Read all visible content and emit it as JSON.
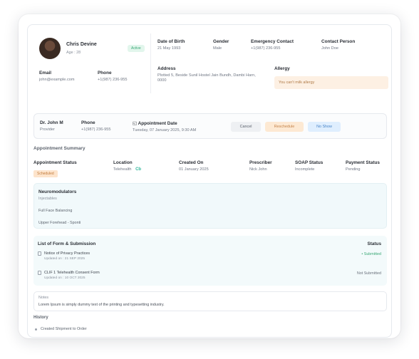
{
  "patient": {
    "name": "Chris Devine",
    "age": "Age : 28",
    "status": "Active",
    "email_label": "Email",
    "email": "john@example.com",
    "phone_label": "Phone",
    "phone": "+1(987) 236-955"
  },
  "info": {
    "dob_label": "Date of Birth",
    "dob": "21 May 1993",
    "gender_label": "Gender",
    "gender": "Male",
    "emergency_label": "Emergency Contact",
    "emergency": "+1(987) 236-955",
    "contact_person_label": "Contact Person",
    "contact_person": "John Doe",
    "address_label": "Address",
    "address": "Plotted 5, Beside Sunil Hostel Jain Bundh, Dambi Harn, 0000",
    "allergy_label": "Allergy",
    "allergy": "You can't milk allergy"
  },
  "doctor": {
    "name": "Dr. John M",
    "role": "Provider",
    "phone_label": "Phone",
    "phone": "+1(987) 236-955",
    "appt_date_label": "Appointment Date",
    "appt_date": "Tuesday, 07 January 2025, 9:30 AM",
    "cancel": "Cancel",
    "reschedule": "Reschedule",
    "no_show": "No Show"
  },
  "summary": {
    "title": "Appointment Summary",
    "status_label": "Appointment Status",
    "status": "Scheduled",
    "location_label": "Location",
    "location": "Telehealth",
    "created_label": "Created On",
    "created": "01 January 2025",
    "prescriber_label": "Prescriber",
    "prescriber": "Nick John",
    "soap_label": "SOAP Status",
    "soap": "Incomplete",
    "payment_label": "Payment Status",
    "payment": "Pending"
  },
  "neuro": {
    "title": "Neuromodulators",
    "subtitle": "Injectables",
    "items": [
      "Full Face Balancing",
      "Upper Forehead - Sponti"
    ]
  },
  "forms": {
    "title": "List of Form & Submission",
    "status_header": "Status",
    "rows": [
      {
        "name": "Notice of Privacy Practices",
        "updated": "Updated on : 21 SEP 2025",
        "status": "Submitted"
      },
      {
        "name": "CLIF 1 Telehealth Consent Form",
        "updated": "Updated on : 10 OCT 2025",
        "status": "Not Submitted"
      }
    ]
  },
  "notes": {
    "label": "Notes",
    "text": "Lorem Ipsum is simply dummy text of the printing and typesetting industry."
  },
  "history": {
    "title": "History",
    "item": "Created Shipment to Order"
  }
}
